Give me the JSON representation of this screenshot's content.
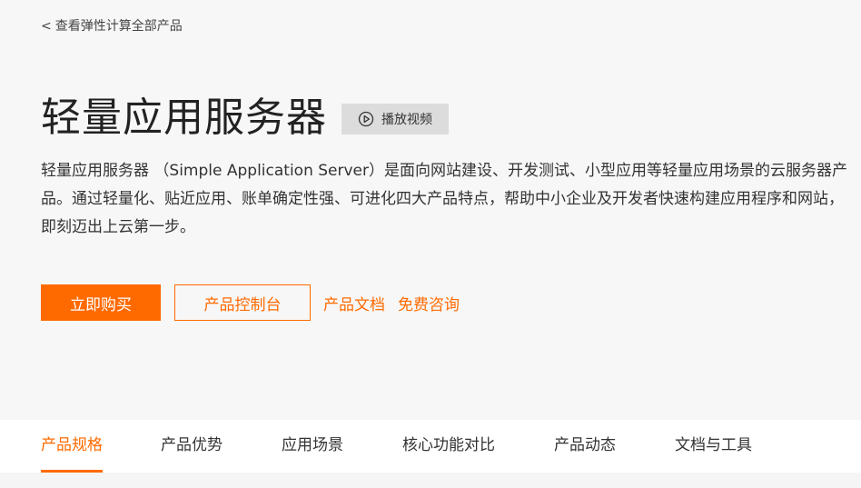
{
  "back_link": {
    "chevron": "<",
    "label": "查看弹性计算全部产品"
  },
  "hero": {
    "title": "轻量应用服务器",
    "video_button": {
      "icon": "play-circle-icon",
      "label": "播放视频"
    },
    "description": "轻量应用服务器 （Simple Application Server）是面向网站建设、开发测试、小型应用等轻量应用场景的云服务器产品。通过轻量化、贴近应用、账单确定性强、可进化四大产品特点，帮助中小企业及开发者快速构建应用程序和网站，即刻迈出上云第一步。",
    "actions": {
      "buy_label": "立即购买",
      "console_label": "产品控制台",
      "docs_label": "产品文档",
      "consult_label": "免费咨询"
    }
  },
  "tabs": [
    {
      "label": "产品规格",
      "active": true
    },
    {
      "label": "产品优势",
      "active": false
    },
    {
      "label": "应用场景",
      "active": false
    },
    {
      "label": "核心功能对比",
      "active": false
    },
    {
      "label": "产品动态",
      "active": false
    },
    {
      "label": "文档与工具",
      "active": false
    }
  ],
  "colors": {
    "accent": "#ff6a00",
    "hero_background": "#f7f7f7",
    "video_button_background": "#dcdcdc"
  }
}
